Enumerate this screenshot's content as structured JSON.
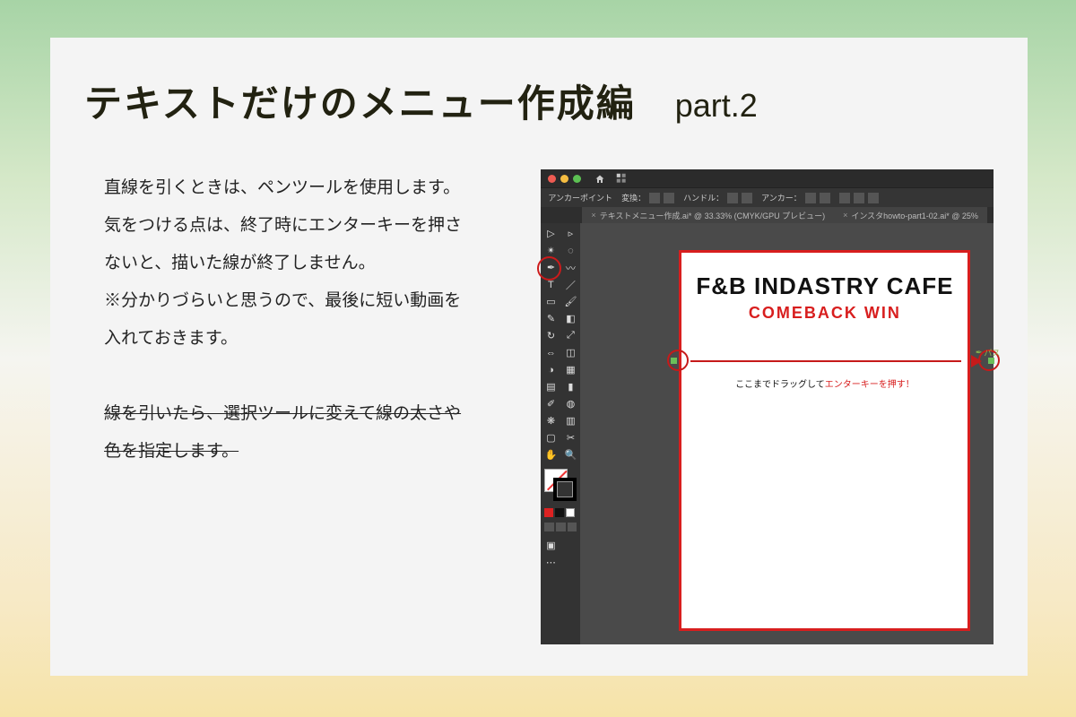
{
  "page": {
    "title": "テキストだけのメニュー作成編",
    "part_label": "part.2"
  },
  "article": {
    "p1": "直線を引くときは、ペンツールを使用します。",
    "p2": "気をつける点は、終了時にエンターキーを押さ",
    "p3": "ないと、描いた線が終了しません。",
    "p4": "※分かりづらいと思うので、最後に短い動画を",
    "p5": "入れておきます。",
    "s1": "線を引いたら、選択ツールに変えて線の太さや",
    "s2": "色を指定します。"
  },
  "ai": {
    "ctrlbar": {
      "label_anchor": "アンカーポイント",
      "label_convert": "変換：",
      "label_handle": "ハンドル：",
      "label_anchor2": "アンカー："
    },
    "tabs": {
      "t1": "テキストメニュー作成.ai* @ 33.33% (CMYK/GPU プレビュー)",
      "t2": "インスタhowto-part1-02.ai* @ 25%"
    },
    "artboard": {
      "title": "F&B INDASTRY CAFE",
      "subtitle": "COMEBACK WIN",
      "caption_pre": "ここまでドラッグして",
      "caption_em": "エンターキーを押す！"
    },
    "hint": {
      "path": "パス"
    }
  }
}
